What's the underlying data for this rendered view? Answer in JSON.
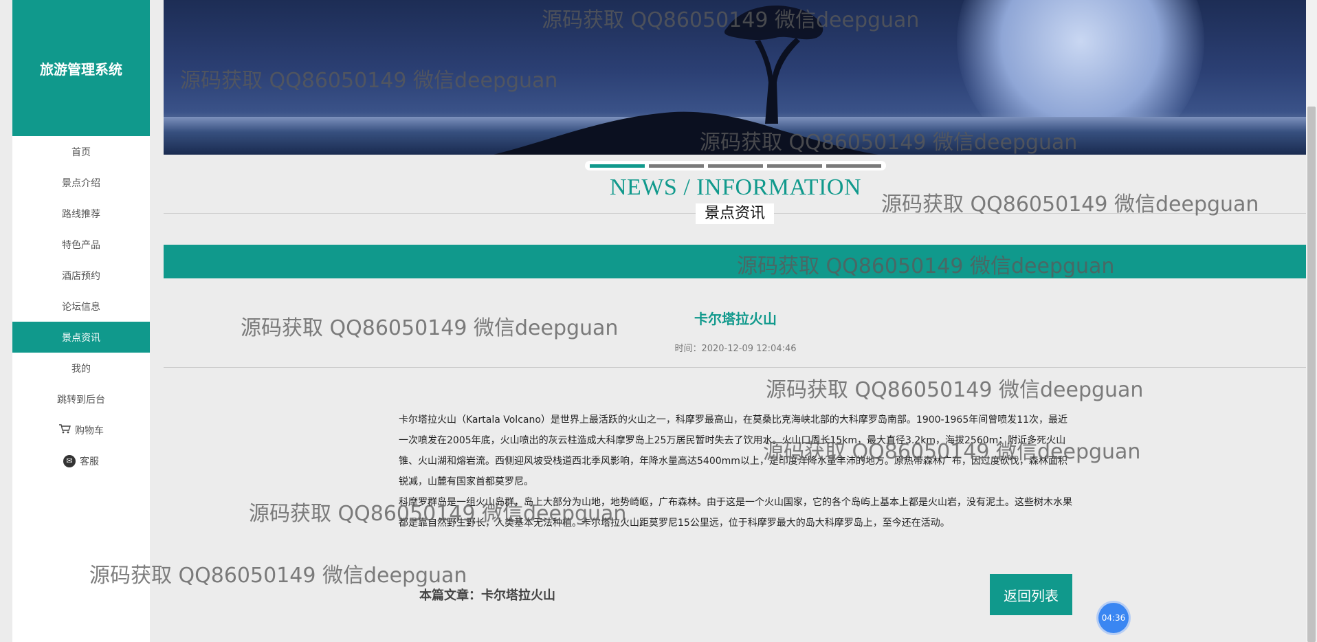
{
  "sidebar": {
    "brand": "旅游管理系统",
    "items": [
      {
        "label": "首页"
      },
      {
        "label": "景点介绍"
      },
      {
        "label": "路线推荐"
      },
      {
        "label": "特色产品"
      },
      {
        "label": "酒店预约"
      },
      {
        "label": "论坛信息"
      },
      {
        "label": "景点资讯"
      },
      {
        "label": "我的"
      },
      {
        "label": "跳转到后台"
      },
      {
        "label": "购物车"
      },
      {
        "label": "客服"
      }
    ],
    "active_item": "景点资讯"
  },
  "carousel": {
    "slides": 5,
    "active_index": 0
  },
  "section": {
    "title_en": "NEWS / INFORMATION",
    "title_cn": "景点资讯"
  },
  "article": {
    "title": "卡尔塔拉火山",
    "time": "时间：2020-12-09 12:04:46",
    "paragraphs": [
      "卡尔塔拉火山（Kartala Volcano）是世界上最活跃的火山之一，科摩罗最高山，在莫桑比克海峡北部的大科摩罗岛南部。1900-1965年间曾喷发11次，最近一次喷发在2005年底，火山喷出的灰云柱造成大科摩罗岛上25万居民暂时失去了饮用水。火山口周长15km，最大直径3.2km，海拔2560m；附近多死火山锥、火山湖和熔岩流。西侧迎风坡受栈道西北季风影响，年降水量高达5400mm以上，是印度洋降水量丰沛的地方。原热带森林广布，因过度砍伐，森林面积锐减，山麓有国家首都莫罗尼。",
      "科摩罗群岛是一组火山岛群，岛上大部分为山地，地势崎岖，广布森林。由于这是一个火山国家，它的各个岛屿上基本上都是火山岩，没有泥土。这些树木水果都是靠自然野生野长，人类基本无法种植。卡尔塔拉火山距莫罗尼15公里远，位于科摩罗最大的岛大科摩罗岛上，至今还在活动。"
    ],
    "footer_label": "本篇文章：卡尔塔拉火山",
    "back_button": "返回列表"
  },
  "timer": "04:36",
  "watermark_text": "源码获取 QQ86050149 微信deepguan",
  "colors": {
    "accent": "#10998c",
    "timer": "#3a86f2"
  }
}
